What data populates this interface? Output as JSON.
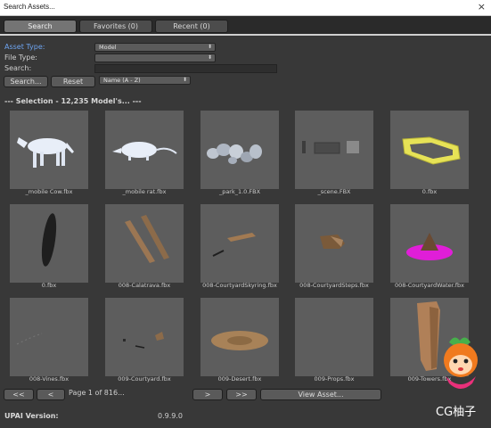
{
  "window": {
    "title": "Search Assets...",
    "close_glyph": "×"
  },
  "tabs": [
    {
      "label": "Search",
      "active": true
    },
    {
      "label": "Favorites (0)",
      "active": false
    },
    {
      "label": "Recent (0)",
      "active": false
    }
  ],
  "form": {
    "asset_type_label": "Asset Type:",
    "asset_type_value": "Model",
    "file_type_label": "File Type:",
    "file_type_value": "",
    "search_label": "Search:",
    "search_value": "",
    "search_button": "Search...",
    "reset_button": "Reset",
    "sort_value": "Name (A - Z)",
    "dropdown_arrow": "⬍"
  },
  "selection_text": "--- Selection - 12,235 Model's... ---",
  "assets": [
    {
      "name": "_mobile Cow.fbx",
      "thumb": "cow"
    },
    {
      "name": "_mobile rat.fbx",
      "thumb": "rat"
    },
    {
      "name": "_park_1.0.FBX",
      "thumb": "rocks"
    },
    {
      "name": "_scene.FBX",
      "thumb": "scene"
    },
    {
      "name": "0.fbx",
      "thumb": "yellow-frame"
    },
    {
      "name": "0.fbx",
      "thumb": "dark-blade"
    },
    {
      "name": "008-Calatrava.fbx",
      "thumb": "planks"
    },
    {
      "name": "008-CourtyardSkyring.fbx",
      "thumb": "skyring"
    },
    {
      "name": "008-CourtyardSteps.fbx",
      "thumb": "steps"
    },
    {
      "name": "008-CourtyardWater.fbx",
      "thumb": "water"
    },
    {
      "name": "008-Vines.fbx",
      "thumb": "vines"
    },
    {
      "name": "009-Courtyard.fbx",
      "thumb": "courtyard"
    },
    {
      "name": "009-Desert.fbx",
      "thumb": "desert"
    },
    {
      "name": "009-Props.fbx",
      "thumb": "empty"
    },
    {
      "name": "009-Towers.fbx",
      "thumb": "towers"
    }
  ],
  "pager": {
    "first": "<<",
    "prev": "<",
    "page_text": "Page 1 of 816...",
    "next": ">",
    "last": ">>",
    "view_asset": "View Asset..."
  },
  "footer": {
    "label": "UPAI Version:",
    "version": "0.9.9.0"
  },
  "watermark": "CG柚子",
  "colors": {
    "background": "#383838",
    "thumb_bg": "#5d5d5d",
    "accent_label": "#6ea4f0",
    "title_bar": "#ffffff"
  }
}
